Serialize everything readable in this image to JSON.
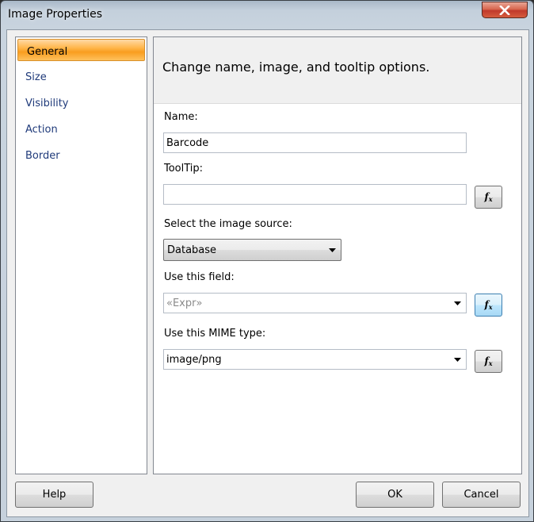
{
  "window": {
    "title": "Image Properties"
  },
  "nav": {
    "items": [
      {
        "label": "General",
        "selected": true
      },
      {
        "label": "Size"
      },
      {
        "label": "Visibility"
      },
      {
        "label": "Action"
      },
      {
        "label": "Border"
      }
    ]
  },
  "main": {
    "header": "Change name, image, and tooltip options.",
    "name": {
      "label": "Name:",
      "value": "Barcode"
    },
    "tooltip": {
      "label": "ToolTip:",
      "value": ""
    },
    "source": {
      "label": "Select the image source:",
      "value": "Database"
    },
    "field": {
      "label": "Use this field:",
      "placeholder": "«Expr»"
    },
    "mime": {
      "label": "Use this MIME type:",
      "value": "image/png"
    },
    "fx": {
      "main": "f",
      "sub": "x"
    }
  },
  "buttons": {
    "help": "Help",
    "ok": "OK",
    "cancel": "Cancel"
  },
  "colors": {
    "selected_nav": "#f99d1f",
    "nav_text": "#1f3a7a",
    "close_button": "#c0392b"
  },
  "icons": {
    "close": "close-x-icon",
    "arrow": "dropdown-arrow-icon",
    "fx": "function-fx-icon"
  }
}
